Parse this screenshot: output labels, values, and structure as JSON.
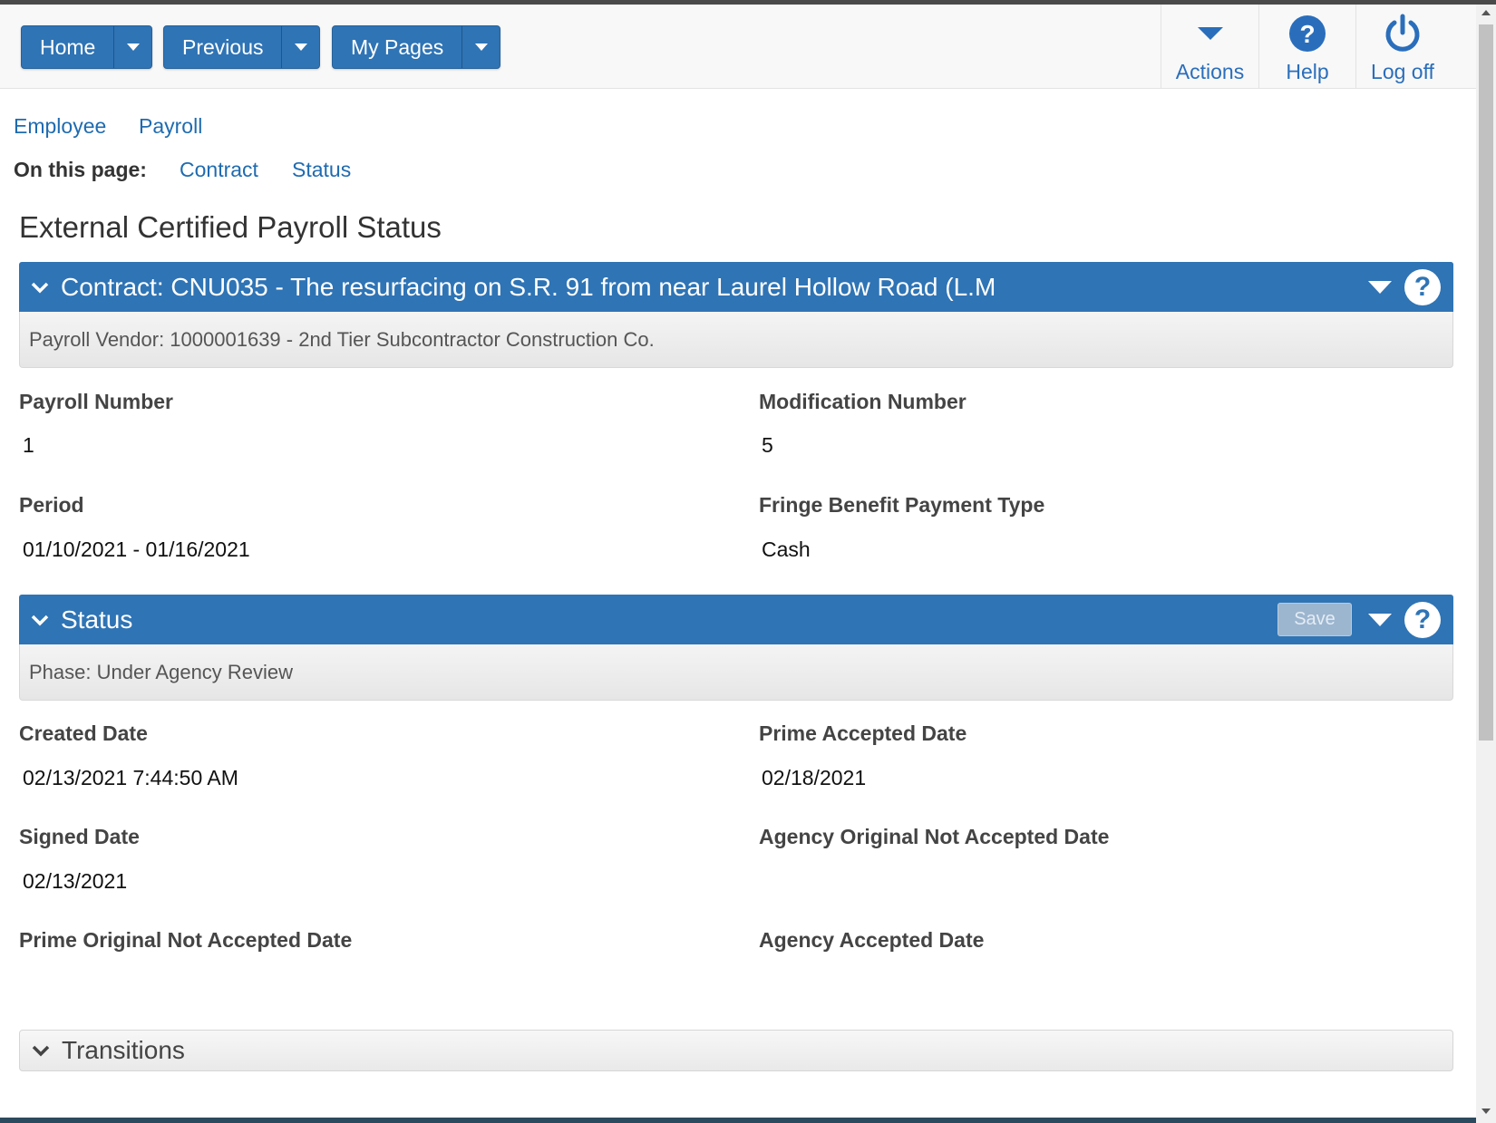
{
  "header": {
    "nav": [
      {
        "label": "Home"
      },
      {
        "label": "Previous"
      },
      {
        "label": "My Pages"
      }
    ],
    "actions_label": "Actions",
    "help_label": "Help",
    "logoff_label": "Log off",
    "accent": "#2f74b5"
  },
  "breadcrumb": {
    "links": [
      "Employee",
      "Payroll"
    ]
  },
  "on_this_page": {
    "label": "On this page:",
    "links": [
      "Contract",
      "Status"
    ]
  },
  "page_title": "External Certified Payroll Status",
  "contract_panel": {
    "title": "Contract: CNU035 - The resurfacing on S.R. 91 from near Laurel Hollow Road (L.M",
    "subtitle": "Payroll Vendor: 1000001639 - 2nd Tier Subcontractor Construction Co.",
    "help_symbol": "?",
    "fields": {
      "payroll_number_label": "Payroll Number",
      "payroll_number": "1",
      "modification_number_label": "Modification Number",
      "modification_number": "5",
      "period_label": "Period",
      "period": "01/10/2021 - 01/16/2021",
      "fringe_label": "Fringe Benefit Payment Type",
      "fringe": "Cash"
    }
  },
  "status_panel": {
    "title": "Status",
    "save_label": "Save",
    "help_symbol": "?",
    "subtitle": "Phase: Under Agency Review",
    "fields": {
      "created_date_label": "Created Date",
      "created_date": "02/13/2021 7:44:50 AM",
      "prime_accepted_label": "Prime Accepted Date",
      "prime_accepted": "02/18/2021",
      "signed_date_label": "Signed Date",
      "signed_date": "02/13/2021",
      "agency_orig_not_accepted_label": "Agency Original Not Accepted Date",
      "prime_orig_not_accepted_label": "Prime Original Not Accepted Date",
      "agency_accepted_label": "Agency Accepted Date"
    }
  },
  "transitions_panel": {
    "title": "Transitions"
  }
}
